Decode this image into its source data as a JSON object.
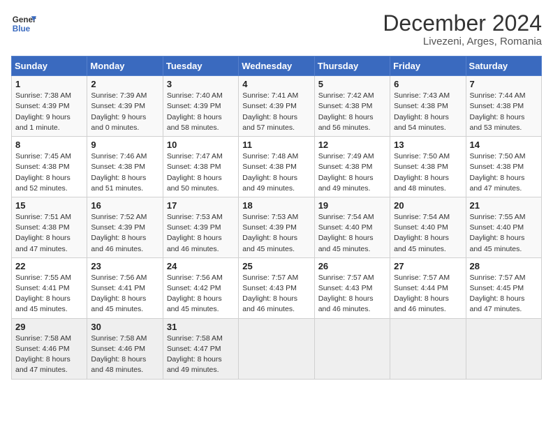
{
  "header": {
    "logo_line1": "General",
    "logo_line2": "Blue",
    "main_title": "December 2024",
    "subtitle": "Livezeni, Arges, Romania"
  },
  "weekdays": [
    "Sunday",
    "Monday",
    "Tuesday",
    "Wednesday",
    "Thursday",
    "Friday",
    "Saturday"
  ],
  "weeks": [
    [
      {
        "day": "1",
        "info": "Sunrise: 7:38 AM\nSunset: 4:39 PM\nDaylight: 9 hours\nand 1 minute."
      },
      {
        "day": "2",
        "info": "Sunrise: 7:39 AM\nSunset: 4:39 PM\nDaylight: 9 hours\nand 0 minutes."
      },
      {
        "day": "3",
        "info": "Sunrise: 7:40 AM\nSunset: 4:39 PM\nDaylight: 8 hours\nand 58 minutes."
      },
      {
        "day": "4",
        "info": "Sunrise: 7:41 AM\nSunset: 4:39 PM\nDaylight: 8 hours\nand 57 minutes."
      },
      {
        "day": "5",
        "info": "Sunrise: 7:42 AM\nSunset: 4:38 PM\nDaylight: 8 hours\nand 56 minutes."
      },
      {
        "day": "6",
        "info": "Sunrise: 7:43 AM\nSunset: 4:38 PM\nDaylight: 8 hours\nand 54 minutes."
      },
      {
        "day": "7",
        "info": "Sunrise: 7:44 AM\nSunset: 4:38 PM\nDaylight: 8 hours\nand 53 minutes."
      }
    ],
    [
      {
        "day": "8",
        "info": "Sunrise: 7:45 AM\nSunset: 4:38 PM\nDaylight: 8 hours\nand 52 minutes."
      },
      {
        "day": "9",
        "info": "Sunrise: 7:46 AM\nSunset: 4:38 PM\nDaylight: 8 hours\nand 51 minutes."
      },
      {
        "day": "10",
        "info": "Sunrise: 7:47 AM\nSunset: 4:38 PM\nDaylight: 8 hours\nand 50 minutes."
      },
      {
        "day": "11",
        "info": "Sunrise: 7:48 AM\nSunset: 4:38 PM\nDaylight: 8 hours\nand 49 minutes."
      },
      {
        "day": "12",
        "info": "Sunrise: 7:49 AM\nSunset: 4:38 PM\nDaylight: 8 hours\nand 49 minutes."
      },
      {
        "day": "13",
        "info": "Sunrise: 7:50 AM\nSunset: 4:38 PM\nDaylight: 8 hours\nand 48 minutes."
      },
      {
        "day": "14",
        "info": "Sunrise: 7:50 AM\nSunset: 4:38 PM\nDaylight: 8 hours\nand 47 minutes."
      }
    ],
    [
      {
        "day": "15",
        "info": "Sunrise: 7:51 AM\nSunset: 4:38 PM\nDaylight: 8 hours\nand 47 minutes."
      },
      {
        "day": "16",
        "info": "Sunrise: 7:52 AM\nSunset: 4:39 PM\nDaylight: 8 hours\nand 46 minutes."
      },
      {
        "day": "17",
        "info": "Sunrise: 7:53 AM\nSunset: 4:39 PM\nDaylight: 8 hours\nand 46 minutes."
      },
      {
        "day": "18",
        "info": "Sunrise: 7:53 AM\nSunset: 4:39 PM\nDaylight: 8 hours\nand 45 minutes."
      },
      {
        "day": "19",
        "info": "Sunrise: 7:54 AM\nSunset: 4:40 PM\nDaylight: 8 hours\nand 45 minutes."
      },
      {
        "day": "20",
        "info": "Sunrise: 7:54 AM\nSunset: 4:40 PM\nDaylight: 8 hours\nand 45 minutes."
      },
      {
        "day": "21",
        "info": "Sunrise: 7:55 AM\nSunset: 4:40 PM\nDaylight: 8 hours\nand 45 minutes."
      }
    ],
    [
      {
        "day": "22",
        "info": "Sunrise: 7:55 AM\nSunset: 4:41 PM\nDaylight: 8 hours\nand 45 minutes."
      },
      {
        "day": "23",
        "info": "Sunrise: 7:56 AM\nSunset: 4:41 PM\nDaylight: 8 hours\nand 45 minutes."
      },
      {
        "day": "24",
        "info": "Sunrise: 7:56 AM\nSunset: 4:42 PM\nDaylight: 8 hours\nand 45 minutes."
      },
      {
        "day": "25",
        "info": "Sunrise: 7:57 AM\nSunset: 4:43 PM\nDaylight: 8 hours\nand 46 minutes."
      },
      {
        "day": "26",
        "info": "Sunrise: 7:57 AM\nSunset: 4:43 PM\nDaylight: 8 hours\nand 46 minutes."
      },
      {
        "day": "27",
        "info": "Sunrise: 7:57 AM\nSunset: 4:44 PM\nDaylight: 8 hours\nand 46 minutes."
      },
      {
        "day": "28",
        "info": "Sunrise: 7:57 AM\nSunset: 4:45 PM\nDaylight: 8 hours\nand 47 minutes."
      }
    ],
    [
      {
        "day": "29",
        "info": "Sunrise: 7:58 AM\nSunset: 4:46 PM\nDaylight: 8 hours\nand 47 minutes."
      },
      {
        "day": "30",
        "info": "Sunrise: 7:58 AM\nSunset: 4:46 PM\nDaylight: 8 hours\nand 48 minutes."
      },
      {
        "day": "31",
        "info": "Sunrise: 7:58 AM\nSunset: 4:47 PM\nDaylight: 8 hours\nand 49 minutes."
      },
      null,
      null,
      null,
      null
    ]
  ]
}
